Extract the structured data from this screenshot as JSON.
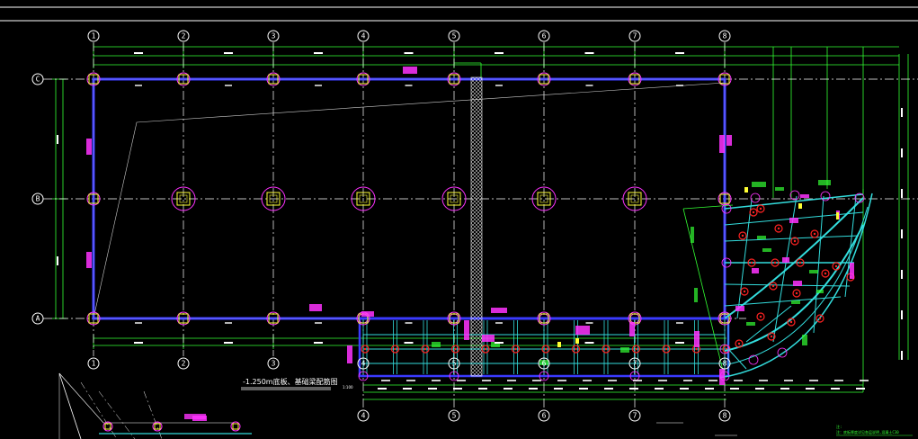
{
  "column_axes_top": [
    "1",
    "2",
    "3",
    "4",
    "5",
    "6",
    "7",
    "8"
  ],
  "column_axes_bottom": [
    "1",
    "2",
    "3",
    "4",
    "5",
    "6",
    "7",
    "8"
  ],
  "column_axes_lower": [
    "4",
    "5",
    "6",
    "7",
    "8"
  ],
  "row_axes": [
    "C",
    "B",
    "A"
  ],
  "drawing_title": "-1.250m底板、基础梁配筋图",
  "drawing_scale": "1:100",
  "note": "注：底板厚度详见各层说明,混凝土C30",
  "colors": {
    "background": "#000000",
    "axis": "#ffffff",
    "beam_outline": "#3a3aff",
    "column_ring": "#ff33ff",
    "column_box": "#ffff33",
    "dimension": "#33ff33",
    "rebar": "#33dddd",
    "node": "#ff2222"
  }
}
